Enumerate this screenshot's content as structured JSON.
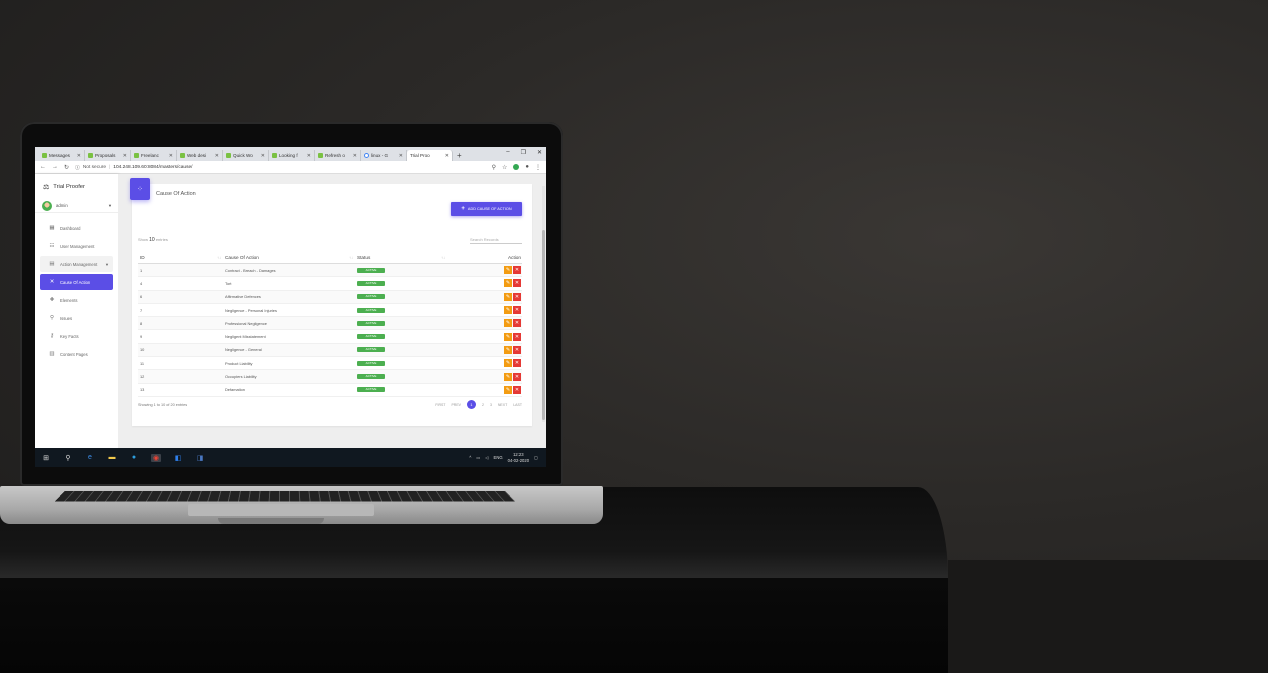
{
  "browser": {
    "tabs": [
      {
        "label": "Messages"
      },
      {
        "label": "Proposals"
      },
      {
        "label": "Freelanc"
      },
      {
        "label": "Web desi"
      },
      {
        "label": "Quick Wo"
      },
      {
        "label": "Looking f"
      },
      {
        "label": "Refresh o"
      },
      {
        "label": "linux - G"
      },
      {
        "label": "Trial Proo"
      }
    ],
    "new_tab": "+",
    "security_label": "Not secure",
    "url": "104.248.109.60:8084/masters/cause/"
  },
  "sidebar": {
    "brand": "Trial Proofer",
    "user": "admin",
    "items": [
      {
        "label": "Dashboard",
        "icon": "▦"
      },
      {
        "label": "User Management",
        "icon": "☷"
      },
      {
        "label": "Action Management",
        "icon": "▤"
      },
      {
        "label": "Cause Of Action",
        "icon": "✕"
      },
      {
        "label": "Elements",
        "icon": "✚"
      },
      {
        "label": "Issues",
        "icon": "⚲"
      },
      {
        "label": "Key Facts",
        "icon": "⚷"
      },
      {
        "label": "Content Pages",
        "icon": "▥"
      }
    ]
  },
  "page": {
    "title": "Cause Of Action",
    "add_button": "ADD CAUSE OF ACTION",
    "show_prefix": "Show",
    "show_count": "10",
    "show_suffix": "entries",
    "search_placeholder": "Search Records"
  },
  "table": {
    "headers": {
      "id": "ID",
      "name": "Cause Of Action",
      "status": "Status",
      "action": "Action"
    },
    "rows": [
      {
        "id": "1",
        "name": "Contract - Breach - Damages",
        "status": "ACTIVE"
      },
      {
        "id": "4",
        "name": "Tort",
        "status": "ACTIVE"
      },
      {
        "id": "6",
        "name": "Affirmative Defences",
        "status": "ACTIVE"
      },
      {
        "id": "7",
        "name": "Negligence - Personal Injuries",
        "status": "ACTIVE"
      },
      {
        "id": "8",
        "name": "Professional Negligence",
        "status": "ACTIVE"
      },
      {
        "id": "9",
        "name": "Negligent Misstatement",
        "status": "ACTIVE"
      },
      {
        "id": "10",
        "name": "Negligence - General",
        "status": "ACTIVE"
      },
      {
        "id": "11",
        "name": "Product Liability",
        "status": "ACTIVE"
      },
      {
        "id": "12",
        "name": "Occupiers Liability",
        "status": "ACTIVE"
      },
      {
        "id": "13",
        "name": "Defamation",
        "status": "ACTIVE"
      }
    ],
    "footer_info": "Showing 1 to 10 of 20 entries",
    "pager": {
      "first": "FIRST",
      "prev": "PREV",
      "current": "1",
      "p2": "2",
      "p3": "3",
      "next": "NEXT",
      "last": "LAST"
    }
  },
  "taskbar": {
    "lang": "ENG",
    "time": "12:23",
    "date": "04-02-2020"
  },
  "colors": {
    "accent": "#5b4ee6",
    "active_badge": "#4caf50",
    "edit": "#f39c12",
    "delete": "#e53935"
  }
}
